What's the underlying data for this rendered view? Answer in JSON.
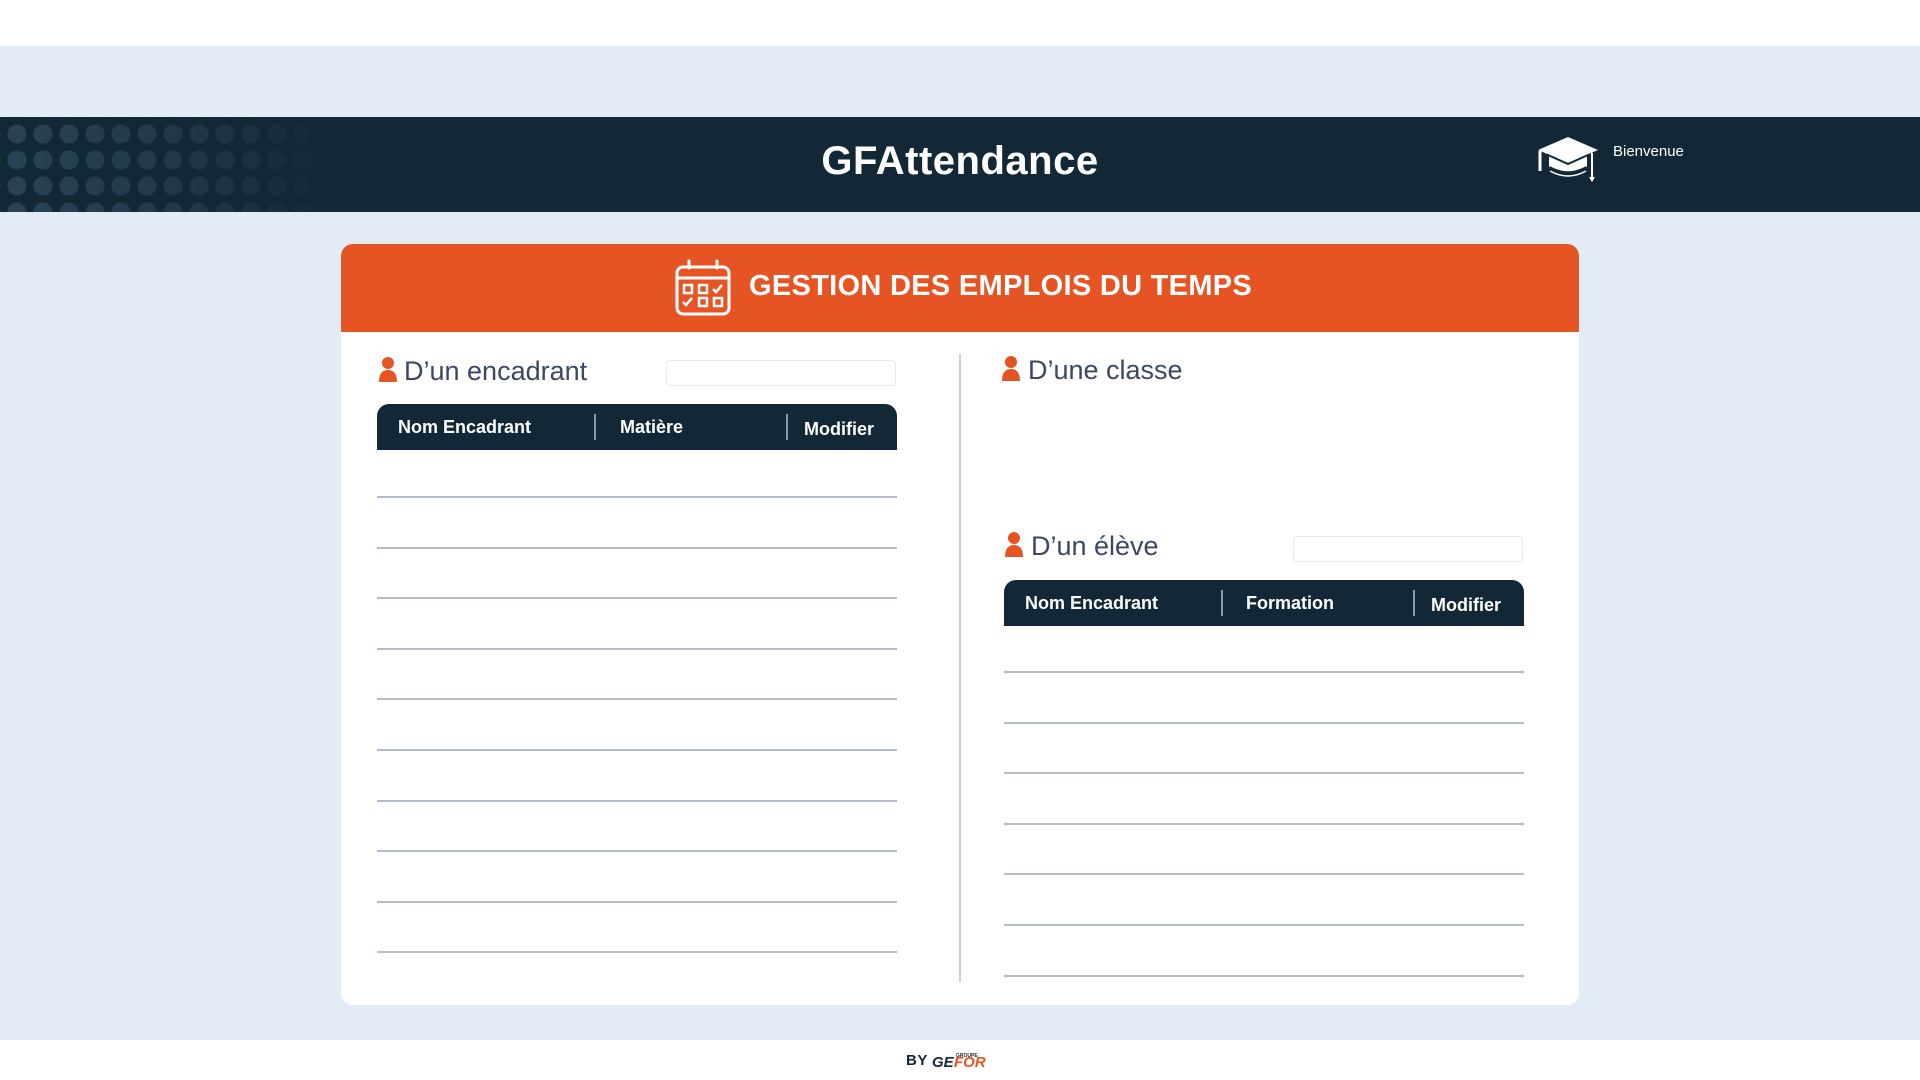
{
  "app": {
    "title": "GFAttendance",
    "welcome": "Bienvenue",
    "icons": {
      "header_icon": "graduation-cap-icon"
    }
  },
  "card": {
    "title": "GESTION DES EMPLOIS DU TEMPS",
    "icon": "calendar-icon",
    "accent_color": "#e75423",
    "dark_color": "#132836"
  },
  "encadrant": {
    "title": "D’un encadrant",
    "icon": "person-icon",
    "search_value": "",
    "columns": [
      "Nom Encadrant",
      "Matière",
      "Modifier"
    ],
    "rows": [
      {
        "nom": "",
        "matiere": "",
        "modifier": ""
      },
      {
        "nom": "",
        "matiere": "",
        "modifier": ""
      },
      {
        "nom": "",
        "matiere": "",
        "modifier": ""
      },
      {
        "nom": "",
        "matiere": "",
        "modifier": ""
      },
      {
        "nom": "",
        "matiere": "",
        "modifier": ""
      },
      {
        "nom": "",
        "matiere": "",
        "modifier": ""
      },
      {
        "nom": "",
        "matiere": "",
        "modifier": ""
      },
      {
        "nom": "",
        "matiere": "",
        "modifier": ""
      },
      {
        "nom": "",
        "matiere": "",
        "modifier": ""
      },
      {
        "nom": "",
        "matiere": "",
        "modifier": ""
      }
    ]
  },
  "classe": {
    "title": "D’une classe",
    "icon": "person-icon"
  },
  "eleve": {
    "title": "D’un élève",
    "icon": "person-icon",
    "search_value": "",
    "columns": [
      "Nom Encadrant",
      "Formation",
      "Modifier"
    ],
    "rows": [
      {
        "nom": "",
        "formation": "",
        "modifier": ""
      },
      {
        "nom": "",
        "formation": "",
        "modifier": ""
      },
      {
        "nom": "",
        "formation": "",
        "modifier": ""
      },
      {
        "nom": "",
        "formation": "",
        "modifier": ""
      },
      {
        "nom": "",
        "formation": "",
        "modifier": ""
      },
      {
        "nom": "",
        "formation": "",
        "modifier": ""
      },
      {
        "nom": "",
        "formation": "",
        "modifier": ""
      }
    ]
  },
  "footer": {
    "by": "BY",
    "brand": "GEFOR",
    "brand_small": "GROUPE"
  }
}
